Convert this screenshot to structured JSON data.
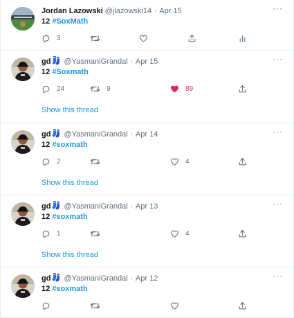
{
  "tweets": [
    {
      "name": "Jordan Lazowski",
      "emoji": "",
      "handle": "@jlazowski14",
      "dot": "·",
      "date": "Apr 15",
      "text_num": "12",
      "hashtag": "#SoxMath",
      "reply_count": "3",
      "retweet_count": "",
      "like_count": "",
      "liked": false,
      "extra_action": "analytics",
      "show_thread": "",
      "avatar_style": "stadium"
    },
    {
      "name": "gd",
      "emoji": "socks",
      "handle": "@YasmaniGrandal",
      "dot": "·",
      "date": "Apr 15",
      "text_num": "12",
      "hashtag": "#Soxmath",
      "reply_count": "24",
      "retweet_count": "9",
      "like_count": "89",
      "liked": true,
      "extra_action": "",
      "show_thread": "Show this thread",
      "avatar_style": "player"
    },
    {
      "name": "gd",
      "emoji": "socks",
      "handle": "@YasmaniGrandal",
      "dot": "·",
      "date": "Apr 14",
      "text_num": "12",
      "hashtag": "#soxmath",
      "reply_count": "2",
      "retweet_count": "",
      "like_count": "4",
      "liked": false,
      "extra_action": "",
      "show_thread": "Show this thread",
      "avatar_style": "player"
    },
    {
      "name": "gd",
      "emoji": "socks",
      "handle": "@YasmaniGrandal",
      "dot": "·",
      "date": "Apr 13",
      "text_num": "12",
      "hashtag": "#soxmath",
      "reply_count": "1",
      "retweet_count": "",
      "like_count": "4",
      "liked": false,
      "extra_action": "",
      "show_thread": "Show this thread",
      "avatar_style": "player"
    },
    {
      "name": "gd",
      "emoji": "socks",
      "handle": "@YasmaniGrandal",
      "dot": "·",
      "date": "Apr 12",
      "text_num": "12",
      "hashtag": "#soxmath",
      "reply_count": "",
      "retweet_count": "",
      "like_count": "",
      "liked": false,
      "extra_action": "",
      "show_thread": "",
      "avatar_style": "player"
    }
  ],
  "more_label": "···",
  "colors": {
    "text": "#0f1419",
    "secondary": "#5b7083",
    "link": "#1b95e0",
    "like_active": "#e0245e",
    "divider": "#e6ecf0"
  },
  "icons": {
    "reply": "reply-icon",
    "retweet": "retweet-icon",
    "like": "heart-icon",
    "share": "share-icon",
    "analytics": "analytics-icon",
    "more": "more-options-icon",
    "emoji": "socks-emoji-icon"
  }
}
